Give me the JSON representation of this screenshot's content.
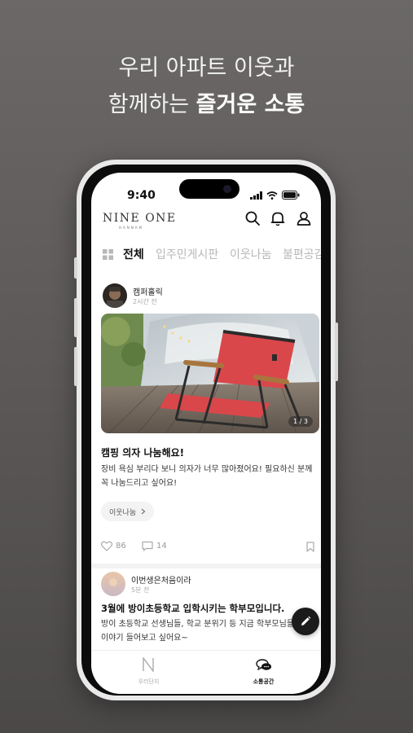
{
  "promo": {
    "line1": "우리 아파트 이웃과",
    "line2_prefix": "함께하는 ",
    "line2_bold": "즐거운 소통"
  },
  "status_bar": {
    "time": "9:40"
  },
  "header": {
    "logo": "NINE ONE",
    "logo_sub": "HANNAM",
    "icons": [
      "search-icon",
      "bell-icon",
      "user-icon"
    ]
  },
  "tabs": {
    "items": [
      {
        "label": "전체",
        "active": true
      },
      {
        "label": "입주민게시판",
        "active": false
      },
      {
        "label": "이웃나눔",
        "active": false
      },
      {
        "label": "불편공감",
        "active": false
      }
    ]
  },
  "post1": {
    "author": "캠퍼홀릭",
    "time": "2시간 전",
    "image_counter": "1 / 3",
    "title": "캠핑 의자 나눔해요!",
    "body": "장비 욕심 부리다 보니 의자가 너무 많아졌어요! 필요하신 분께 꼭 나눔드리고 싶어요!",
    "category": "이웃나눔",
    "likes": "86",
    "comments": "14"
  },
  "post2": {
    "author": "이번생은처음이라",
    "time": "5분 전",
    "title": "3월에 방이초등학교 입학시키는 학부모입니다.",
    "body": "방이 초등학교 선생님들, 학교 분위기 등 지금 학부모님들 실제 이야기 들어보고 싶어요~"
  },
  "bottom_nav": {
    "items": [
      {
        "label": "우리단지",
        "icon": "n-logo-icon",
        "active": false
      },
      {
        "label": "소통공간",
        "icon": "chat-bubbles-icon",
        "active": true
      }
    ]
  },
  "colors": {
    "background": "#5f5c5b",
    "chair_red": "#d9474b",
    "fab": "#1b1b1b"
  }
}
